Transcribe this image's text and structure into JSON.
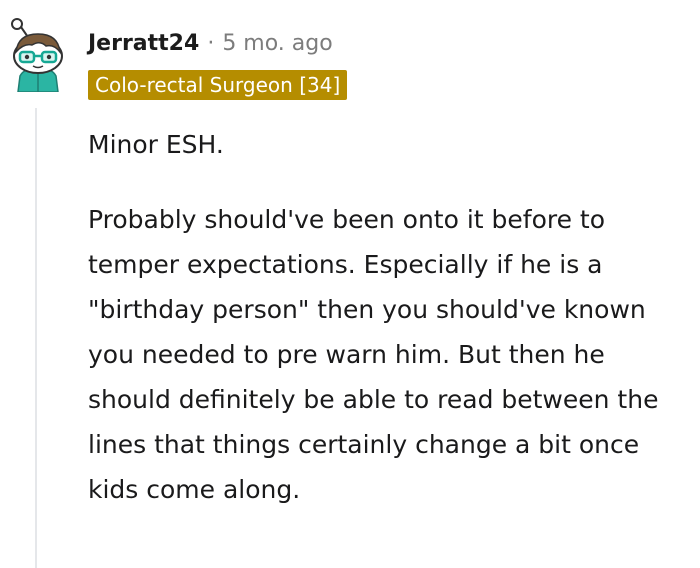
{
  "comment": {
    "author": "Jerratt24",
    "separator": "·",
    "timestamp": "5 mo. ago",
    "flair": "Colo-rectal Surgeon [34]",
    "paragraphs": [
      "Minor ESH.",
      "Probably should've been onto it before to temper expectations. Especially if he is a \"birthday person\" then you should've known you needed to pre warn him. But then he should definitely be able to read between the lines that things certainly change a bit once kids come along."
    ]
  },
  "colors": {
    "flair_background": "#b58d00",
    "avatar_shirt": "#2bb5a3",
    "avatar_glasses": "#16a894"
  },
  "icons": {
    "avatar": "snoo-avatar-icon"
  }
}
